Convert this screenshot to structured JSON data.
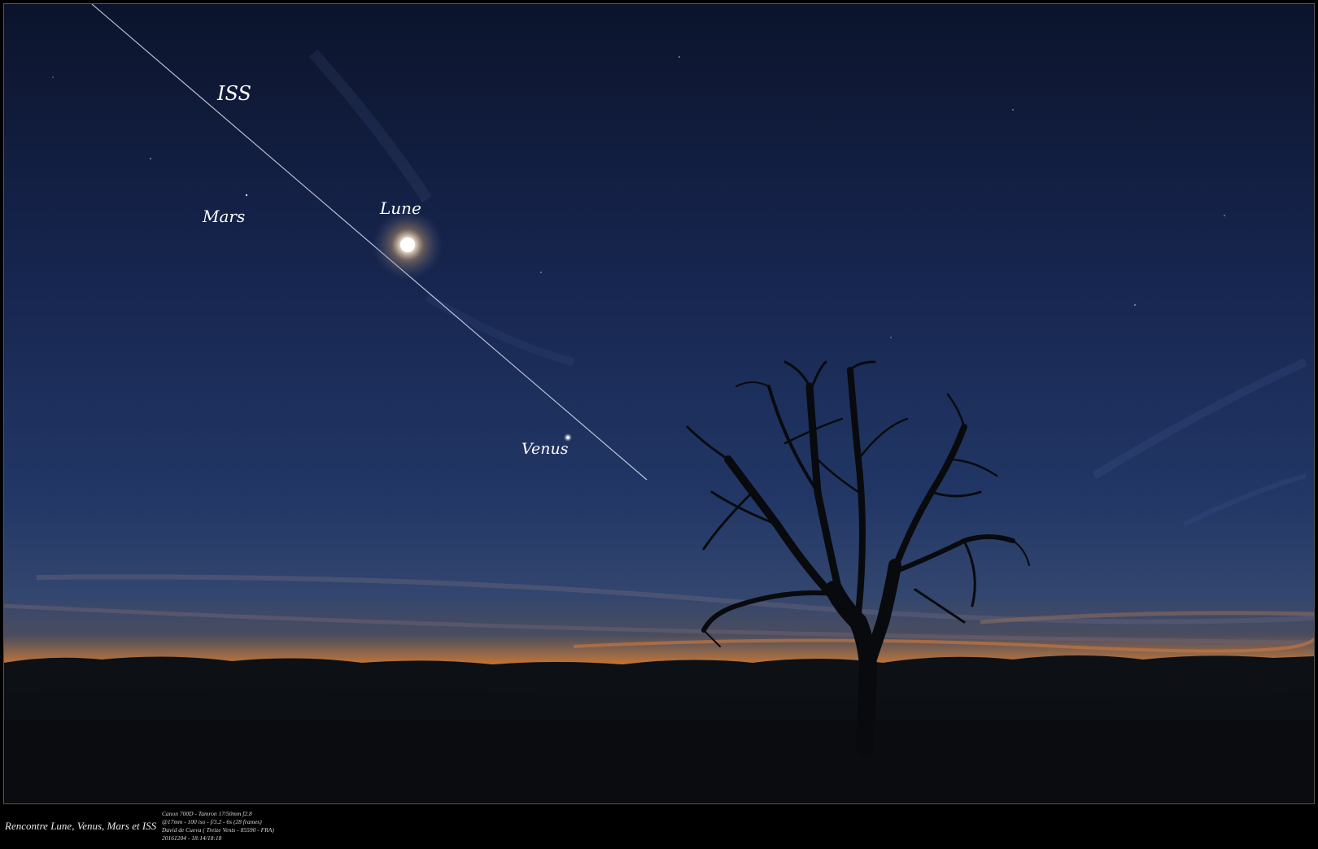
{
  "labels": {
    "iss": "ISS",
    "mars": "Mars",
    "lune": "Lune",
    "venus": "Venus"
  },
  "caption": {
    "title": "Rencontre Lune, Venus, Mars et ISS",
    "meta_lines": [
      "Canon 700D - Tamron 17/50mm f2.8",
      "@17mm - 100 iso - f/3.2 - 6s (28 frames)",
      "David de Cueva ( Treize Vents - 85590 - FRA)",
      "20161204 - 18:14/18:18"
    ]
  },
  "colors": {
    "sky_top": "#0d1630",
    "sky_mid": "#1d2f5c",
    "horizon_glow": "#e0702a",
    "ground": "#0b0d10"
  }
}
